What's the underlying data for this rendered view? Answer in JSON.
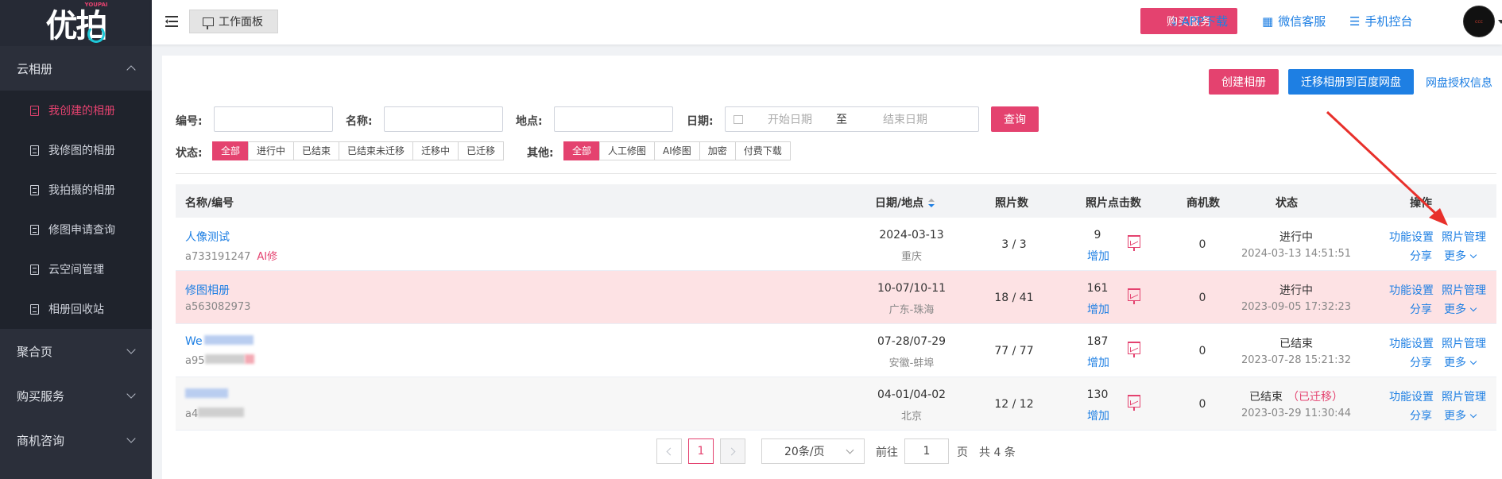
{
  "brand": {
    "logo_text": "优拍",
    "logo_sub": "YOUPAI"
  },
  "sidebar": {
    "groups": [
      {
        "label": "云相册",
        "expanded": true
      },
      {
        "label": "聚合页",
        "expanded": false
      },
      {
        "label": "购买服务",
        "expanded": false
      },
      {
        "label": "商机咨询",
        "expanded": false
      }
    ],
    "items": [
      {
        "label": "我创建的相册",
        "active": true
      },
      {
        "label": "我修图的相册"
      },
      {
        "label": "我拍摄的相册"
      },
      {
        "label": "修图申请查询"
      },
      {
        "label": "云空间管理"
      },
      {
        "label": "相册回收站"
      }
    ]
  },
  "topbar": {
    "workbench": "工作面板",
    "buy": "购买服务",
    "app": "APP下载",
    "wechat": "微信客服",
    "mobile": "手机控台",
    "avatar_text": "ccc"
  },
  "actions": {
    "create": "创建相册",
    "migrate": "迁移相册到百度网盘",
    "auth": "网盘授权信息"
  },
  "filters": {
    "no_label": "编号:",
    "name_label": "名称:",
    "place_label": "地点:",
    "date_label": "日期:",
    "start_date": "开始日期",
    "to": "至",
    "end_date": "结束日期",
    "query": "查询",
    "status_label": "状态:",
    "status_options": [
      "全部",
      "进行中",
      "已结束",
      "已结束未迁移",
      "迁移中",
      "已迁移"
    ],
    "other_label": "其他:",
    "other_options": [
      "全部",
      "人工修图",
      "AI修图",
      "加密",
      "付费下载"
    ]
  },
  "table": {
    "headers": {
      "name": "名称/编号",
      "date": "日期/地点",
      "photos": "照片数",
      "clicks": "照片点击数",
      "leads": "商机数",
      "status": "状态",
      "ops": "操作"
    },
    "add_label": "增加",
    "op_settings": "功能设置",
    "op_photos": "照片管理",
    "op_share": "分享",
    "op_more": "更多",
    "rows": [
      {
        "name": "人像测试",
        "code": "a733191247",
        "tag": "AI修",
        "date": "2024-03-13",
        "place": "重庆",
        "photos": "3 / 3",
        "clicks": "9",
        "leads": "0",
        "status": "进行中",
        "migrated": "",
        "time": "2024-03-13 14:51:51"
      },
      {
        "name": "修图相册",
        "code": "a563082973",
        "tag": "",
        "date": "10-07/10-11",
        "place": "广东-珠海",
        "photos": "18 / 41",
        "clicks": "161",
        "leads": "0",
        "status": "进行中",
        "migrated": "",
        "time": "2023-09-05 17:32:23"
      },
      {
        "name": "We",
        "code": "a95",
        "tag": "",
        "date": "07-28/07-29",
        "place": "安徽-蚌埠",
        "photos": "77 / 77",
        "clicks": "187",
        "leads": "0",
        "status": "已结束",
        "migrated": "",
        "time": "2023-07-28 15:21:32"
      },
      {
        "name": "",
        "code": "a4",
        "tag": "",
        "date": "04-01/04-02",
        "place": "北京",
        "photos": "12 / 12",
        "clicks": "130",
        "leads": "0",
        "status": "已结束",
        "migrated": "（已迁移）",
        "time": "2023-03-29 11:30:44"
      }
    ]
  },
  "pagination": {
    "current": "1",
    "page_size": "20条/页",
    "goto_label": "前往",
    "goto_value": "1",
    "page_unit": "页",
    "total": "共 4 条"
  },
  "colors": {
    "accent": "#e4426f",
    "link": "#1e7fe3",
    "sidebar": "#2b2f3a"
  }
}
